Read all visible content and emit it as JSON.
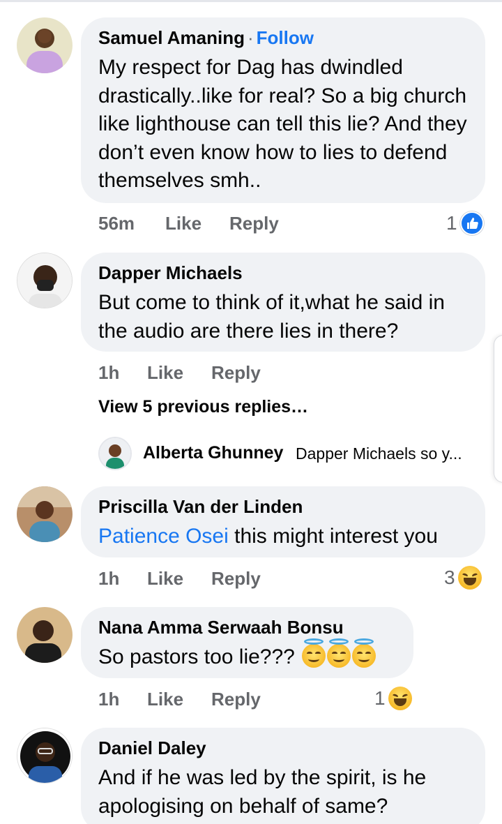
{
  "comments": [
    {
      "name": "Samuel Amaning",
      "follow": "Follow",
      "separator": "·",
      "text": "My respect for Dag has dwindled drastically..like for real? So a big church like lighthouse can tell this lie? And they don’t even know how to lies to defend themselves smh..",
      "time": "56m",
      "like": "Like",
      "reply": "Reply",
      "reaction_count": "1",
      "reaction_icon": "like-icon"
    },
    {
      "name": "Dapper Michaels",
      "text": "But come to think of it,what he said in the audio are there lies in there?",
      "time": "1h",
      "like": "Like",
      "reply": "Reply",
      "view_replies": "View 5 previous replies…",
      "reply_preview": {
        "name": "Alberta Ghunney",
        "text": "Dapper Michaels so y..."
      }
    },
    {
      "name": "Priscilla Van der Linden",
      "mention": "Patience Osei",
      "text": " this might interest you",
      "time": "1h",
      "like": "Like",
      "reply": "Reply",
      "reaction_count": "3",
      "reaction_icon": "haha-icon"
    },
    {
      "name": "Nana Amma Serwaah Bonsu",
      "text": "So pastors too lie???",
      "emojis": [
        "angel-emoji",
        "angel-emoji",
        "angel-emoji"
      ],
      "time": "1h",
      "like": "Like",
      "reply": "Reply",
      "reaction_count": "1",
      "reaction_icon": "haha-icon"
    },
    {
      "name": "Daniel Daley",
      "text": "And if he was led by the spirit, is he apologising on behalf of same?"
    }
  ],
  "colors": {
    "bubble": "#f0f2f5",
    "link": "#1877f2",
    "meta": "#65676b",
    "text": "#050505"
  }
}
